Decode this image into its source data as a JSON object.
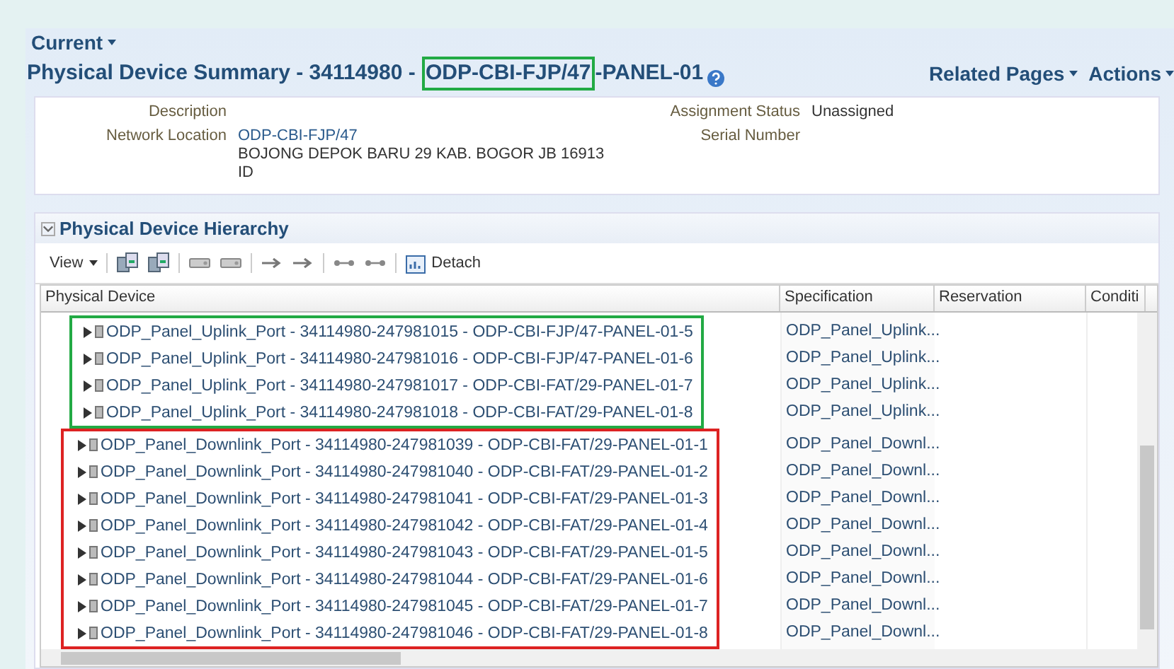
{
  "header": {
    "menu": "Current",
    "title_start": "Physical Device Summary - 34114980 - ",
    "title_highlight": "ODP-CBI-FJP/47",
    "title_end": "-PANEL-01",
    "menus": [
      "Related Pages",
      "Actions"
    ]
  },
  "details": {
    "left": [
      {
        "label": "Description"
      },
      {
        "label": "Network Location",
        "value": [
          "ODP-CBI-FJP/47",
          "BOJONG DEPOK BARU 29 KAB. BOGOR JB 16913",
          "ID"
        ]
      }
    ],
    "right": [
      {
        "label": "Assignment Status",
        "value": "Unassigned"
      },
      {
        "label": "Serial Number"
      }
    ]
  },
  "hierarchy": {
    "title": "Physical Device Hierarchy",
    "expanded": true,
    "view": "View",
    "detach": "Detach",
    "columns": [
      "Physical Device",
      "Specification",
      "Reservation",
      "Conditi"
    ],
    "groups": [
      {
        "color": "#22aa44",
        "rows": [
          {
            "device": "ODP_Panel_Uplink_Port - 34114980-247981015 - ODP-CBI-FJP/47-PANEL-01-5",
            "specification": "ODP_Panel_Uplink..."
          },
          {
            "device": "ODP_Panel_Uplink_Port - 34114980-247981016 - ODP-CBI-FJP/47-PANEL-01-6",
            "specification": "ODP_Panel_Uplink..."
          },
          {
            "device": "ODP_Panel_Uplink_Port - 34114980-247981017 - ODP-CBI-FAT/29-PANEL-01-7",
            "specification": "ODP_Panel_Uplink..."
          },
          {
            "device": "ODP_Panel_Uplink_Port - 34114980-247981018 - ODP-CBI-FAT/29-PANEL-01-8",
            "specification": "ODP_Panel_Uplink..."
          }
        ]
      },
      {
        "color": "#dd2222",
        "rows": [
          {
            "device": "ODP_Panel_Downlink_Port - 34114980-247981039 - ODP-CBI-FAT/29-PANEL-01-1",
            "specification": "ODP_Panel_Downl..."
          },
          {
            "device": "ODP_Panel_Downlink_Port - 34114980-247981040 - ODP-CBI-FAT/29-PANEL-01-2",
            "specification": "ODP_Panel_Downl..."
          },
          {
            "device": "ODP_Panel_Downlink_Port - 34114980-247981041 - ODP-CBI-FAT/29-PANEL-01-3",
            "specification": "ODP_Panel_Downl..."
          },
          {
            "device": "ODP_Panel_Downlink_Port - 34114980-247981042 - ODP-CBI-FAT/29-PANEL-01-4",
            "specification": "ODP_Panel_Downl..."
          },
          {
            "device": "ODP_Panel_Downlink_Port - 34114980-247981043 - ODP-CBI-FAT/29-PANEL-01-5",
            "specification": "ODP_Panel_Downl..."
          },
          {
            "device": "ODP_Panel_Downlink_Port - 34114980-247981044 - ODP-CBI-FAT/29-PANEL-01-6",
            "specification": "ODP_Panel_Downl..."
          },
          {
            "device": "ODP_Panel_Downlink_Port - 34114980-247981045 - ODP-CBI-FAT/29-PANEL-01-7",
            "specification": "ODP_Panel_Downl..."
          },
          {
            "device": "ODP_Panel_Downlink_Port - 34114980-247981046 - ODP-CBI-FAT/29-PANEL-01-8",
            "specification": "ODP_Panel_Downl..."
          }
        ]
      }
    ]
  }
}
